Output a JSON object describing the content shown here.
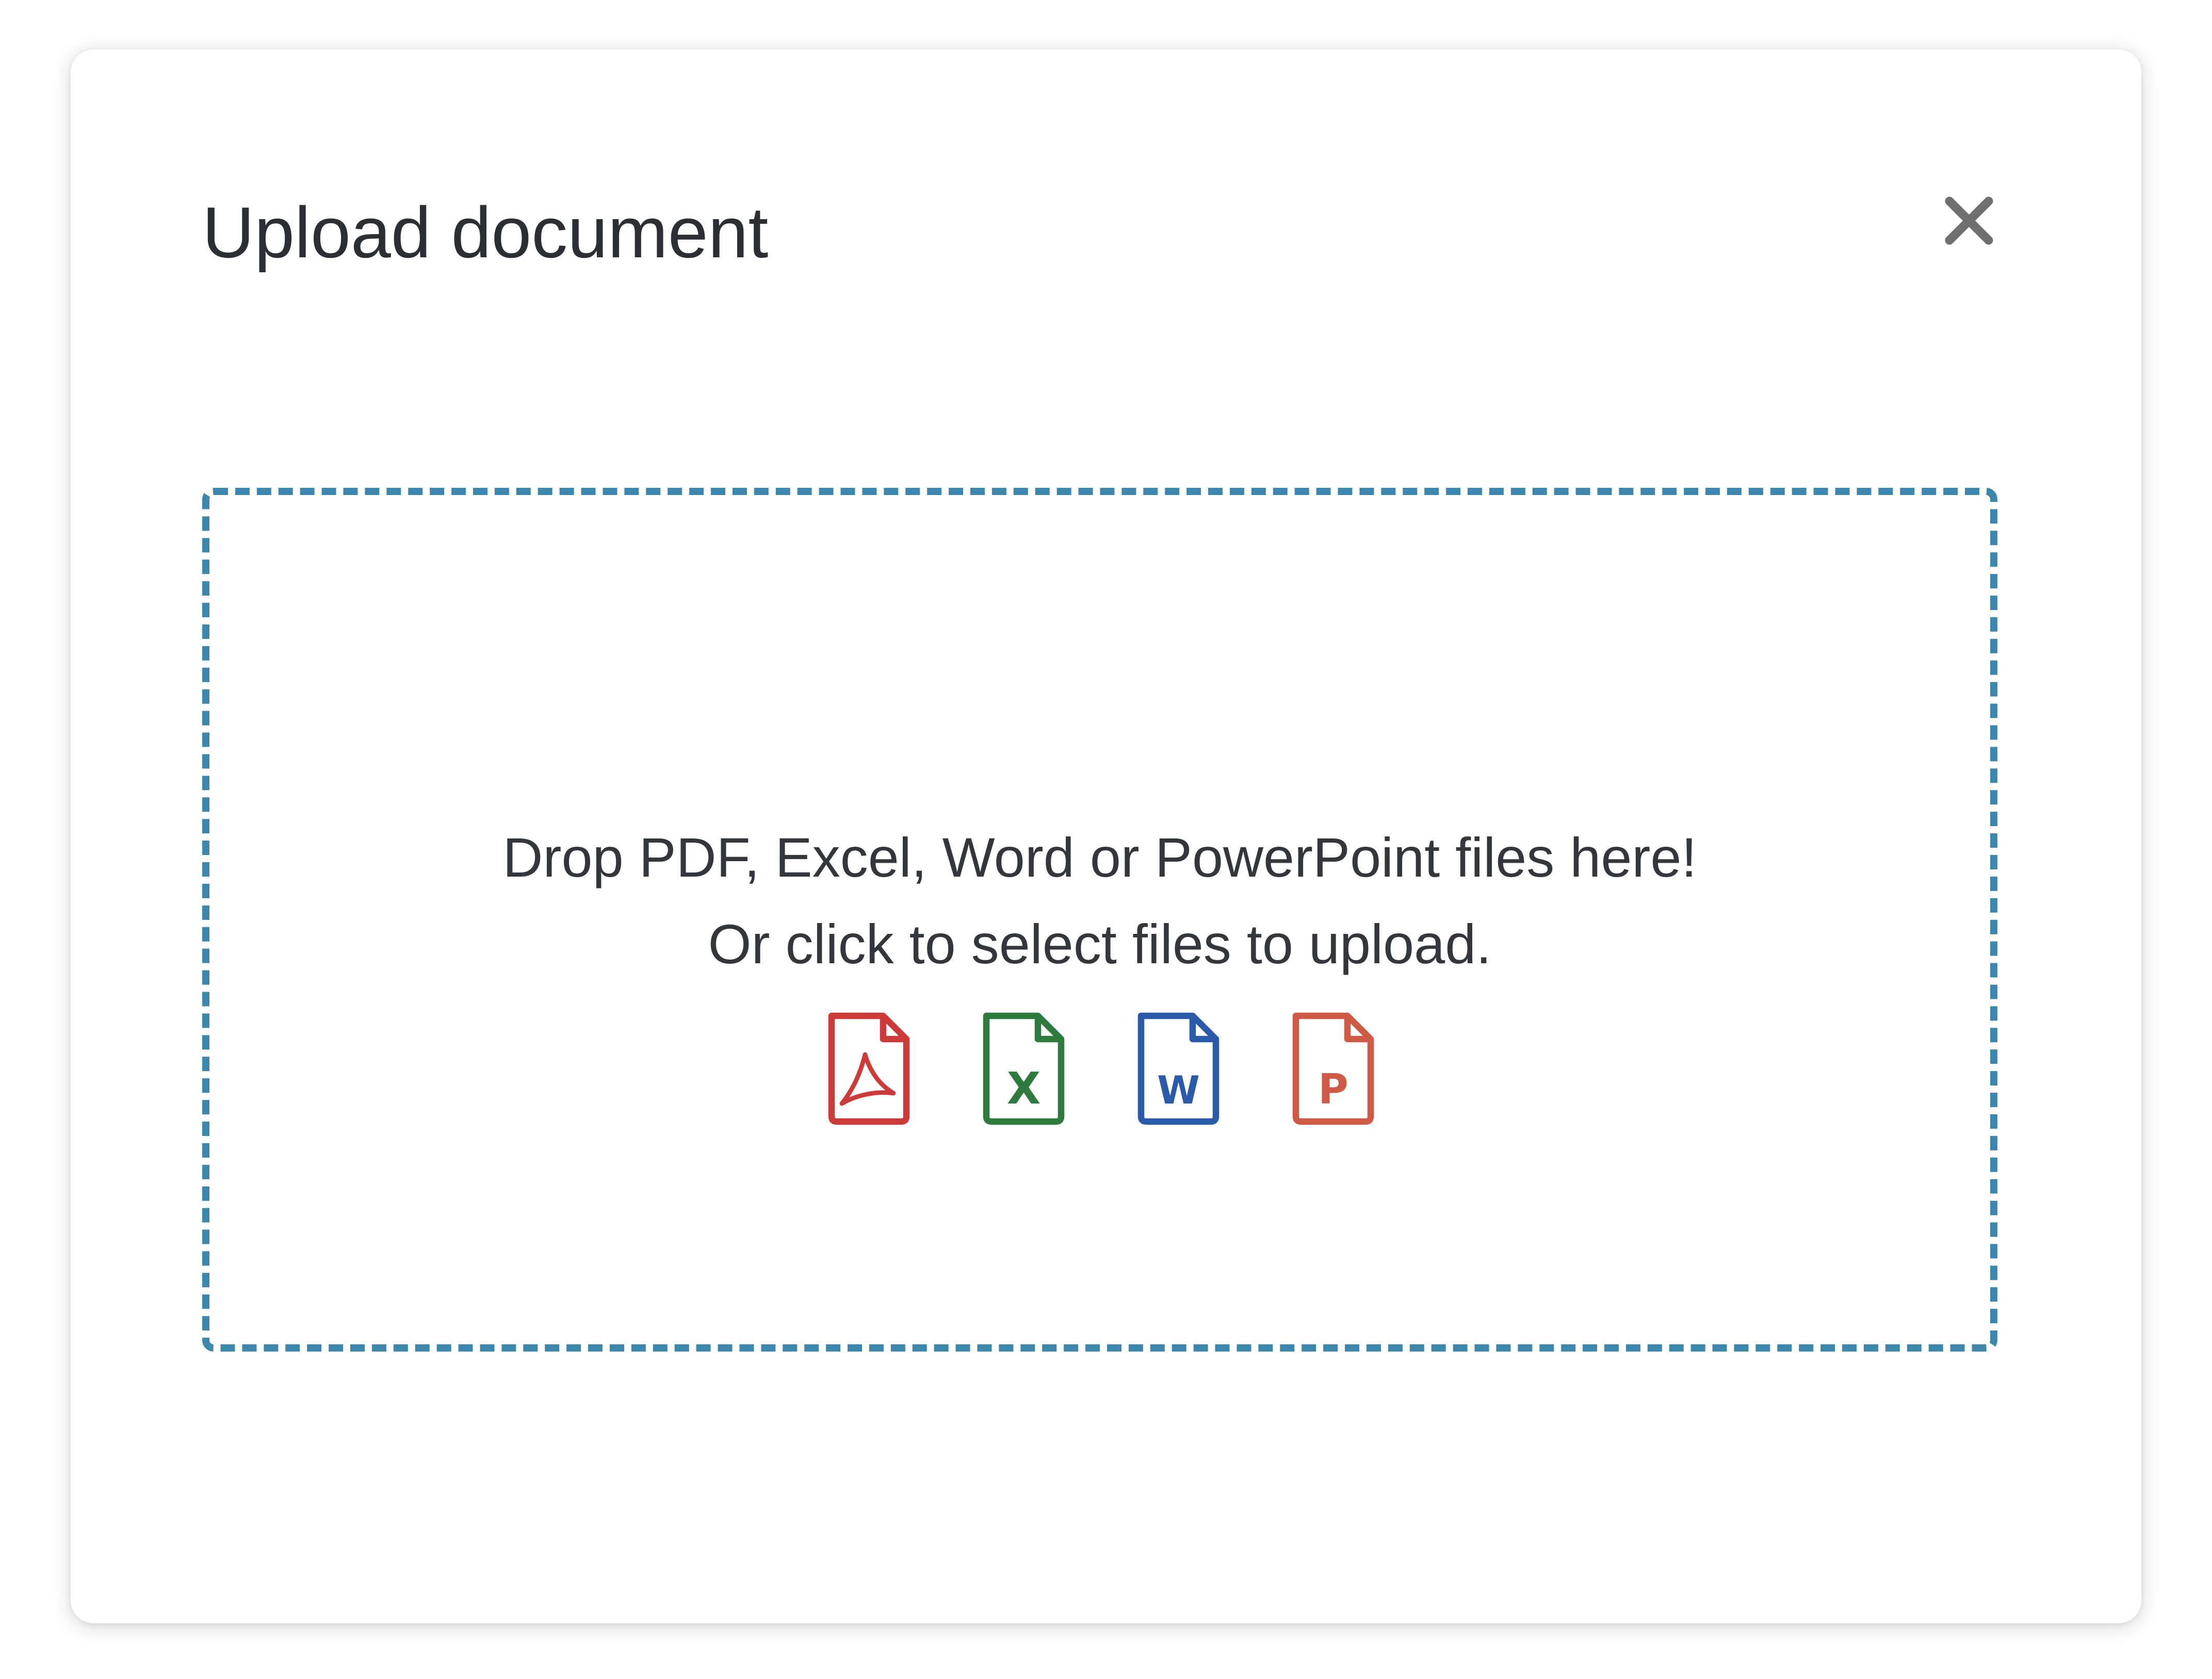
{
  "dialog": {
    "title": "Upload document",
    "close_icon": "close-icon"
  },
  "dropzone": {
    "line1": "Drop PDF, Excel, Word or PowerPoint files here!",
    "line2": "Or click to select files to upload.",
    "border_color": "#3d87ac",
    "icons": [
      {
        "name": "pdf-file-icon",
        "glyph": "",
        "color": "#cc3a3a"
      },
      {
        "name": "excel-file-icon",
        "glyph": "X",
        "color": "#2f7a3e"
      },
      {
        "name": "word-file-icon",
        "glyph": "W",
        "color": "#2b5aa8"
      },
      {
        "name": "powerpoint-file-icon",
        "glyph": "P",
        "color": "#cf5a45"
      }
    ]
  }
}
